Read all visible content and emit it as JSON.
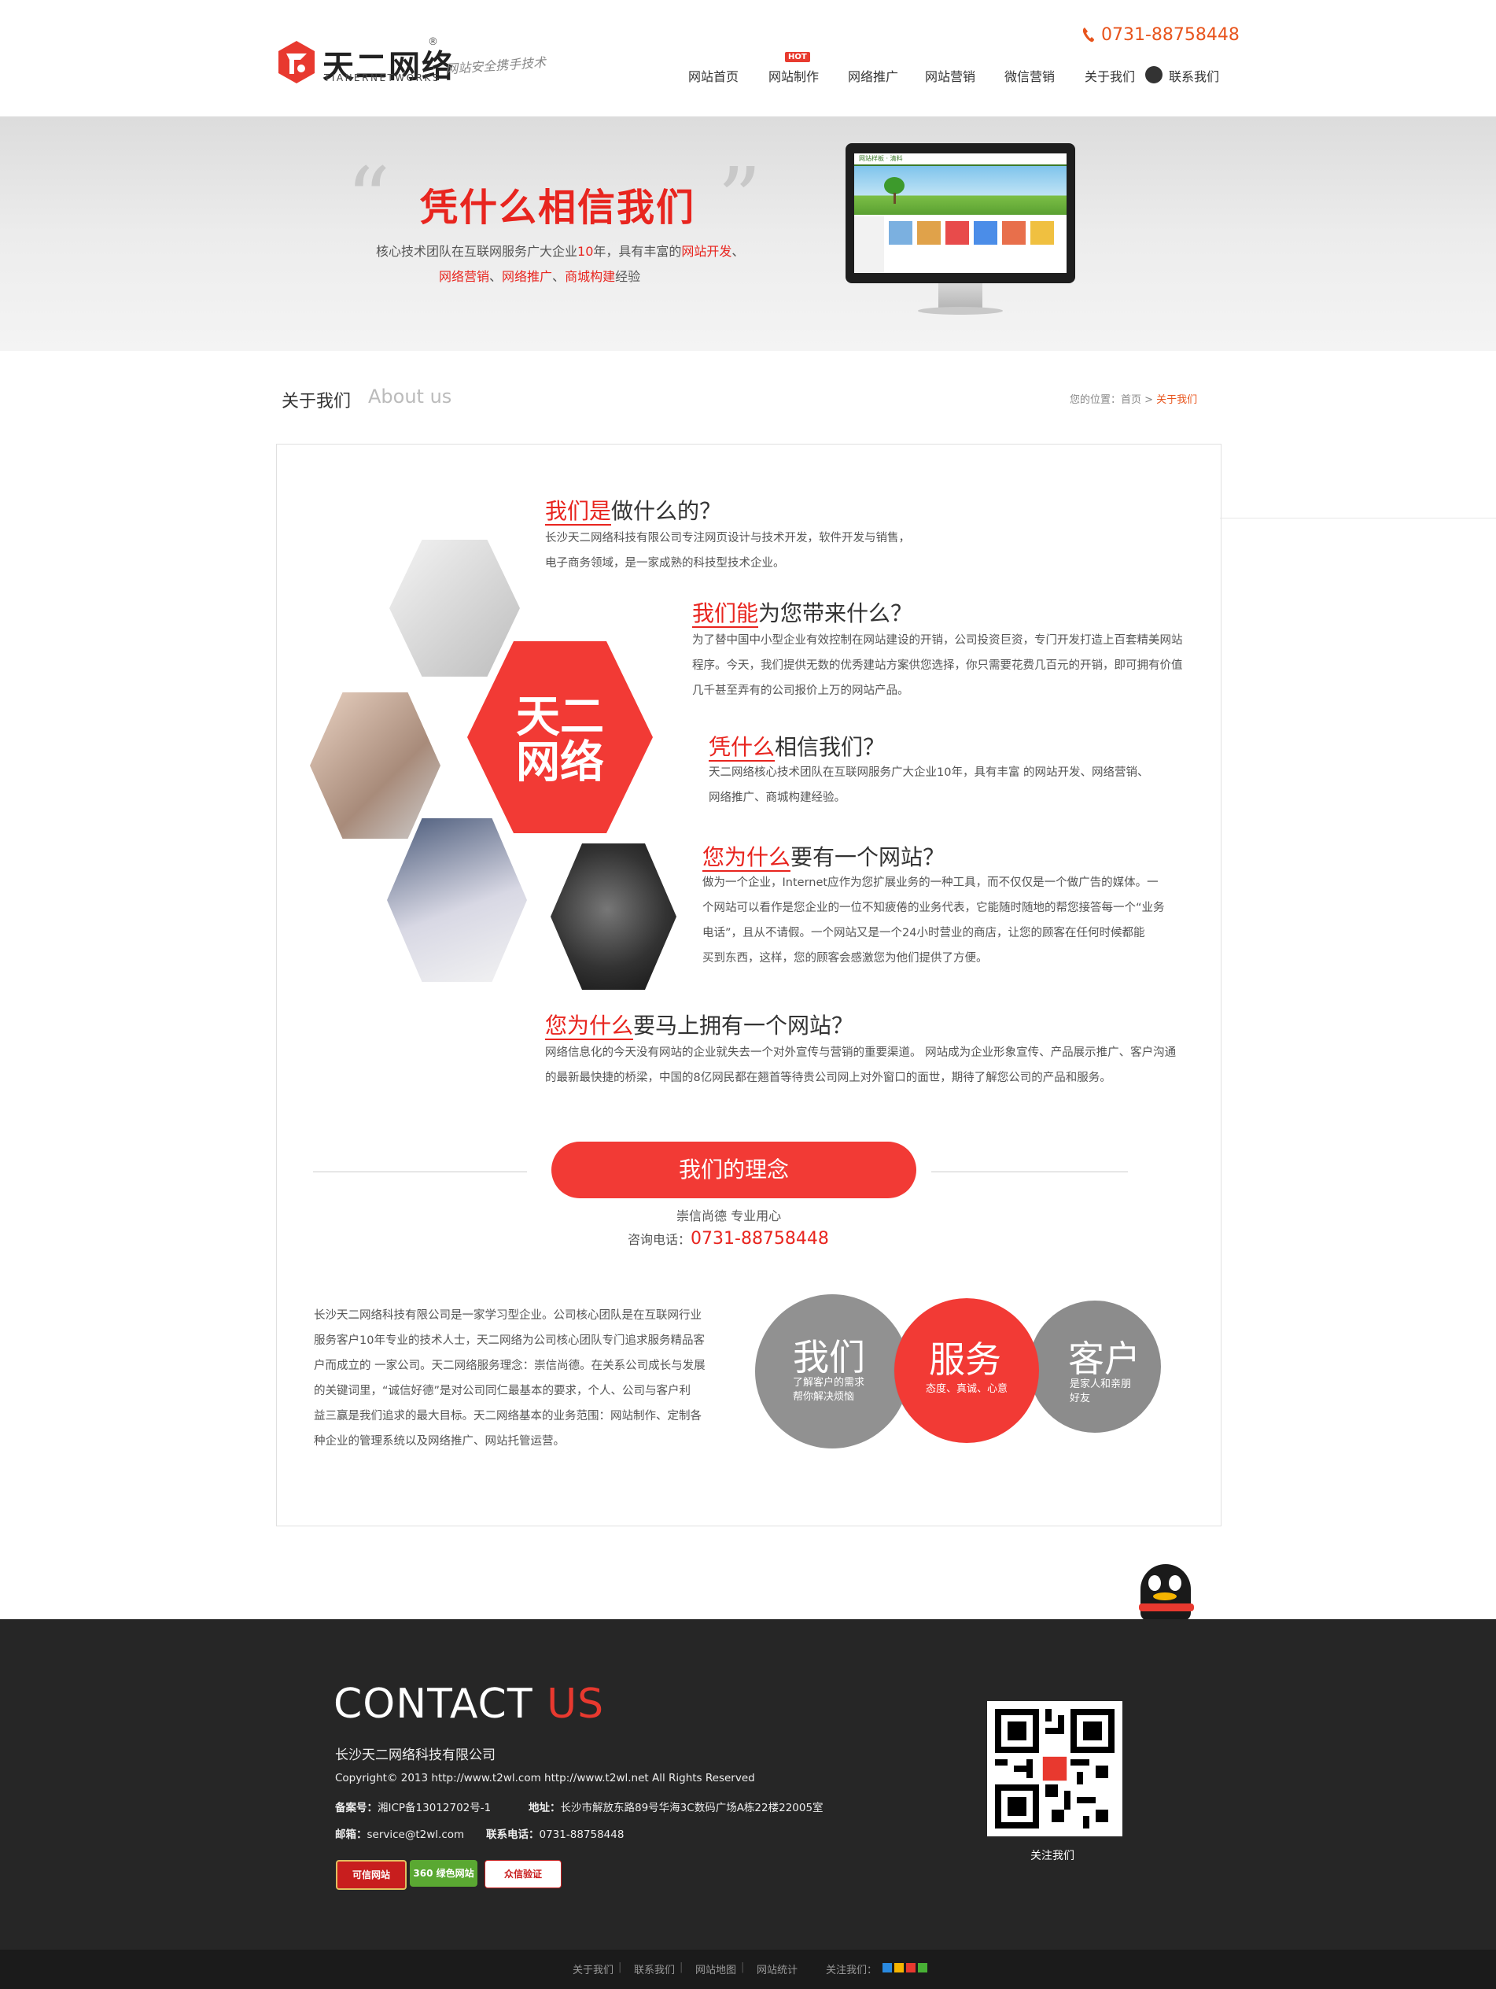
{
  "header": {
    "logo_cn": "天二网络",
    "logo_en": "TIANERNETWORKS",
    "logo_reg": "®",
    "slogan": "网站安全携手技术",
    "phone": "0731-88758448",
    "hot_badge": "HOT",
    "nav": [
      "网站首页",
      "网站制作",
      "网络推广",
      "网站营销",
      "微信营销",
      "关于我们",
      "联系我们"
    ]
  },
  "banner": {
    "title": "凭什么相信我们",
    "line1_a": "核心技术团队在互联网服务广大企业",
    "line1_num": "10",
    "line1_b": "年，具有丰富的",
    "line1_c": "网站开发",
    "line1_d": "、",
    "line2_a": "网络营销",
    "line2_b": "、",
    "line2_c": "网络推广",
    "line2_d": "、",
    "line2_e": "商城构建",
    "line2_f": "经验",
    "monitor_site_title": "网站样板 · 清料"
  },
  "section": {
    "title": "关于我们",
    "title_en": "About us",
    "crumb_prefix": "您的位置：首页 > ",
    "crumb_current": "关于我们"
  },
  "hex_center": {
    "line1": "天二",
    "line2": "网络"
  },
  "blocks": [
    {
      "ul": "我们是",
      "rest": "做什么的？",
      "text": [
        "长沙天二网络科技有限公司专注网页设计与技术开发，软件开发与销售，",
        "电子商务领域，是一家成熟的科技型技术企业。"
      ]
    },
    {
      "ul": "我们能",
      "rest": "为您带来什么？",
      "text": [
        "为了替中国中小型企业有效控制在网站建设的开销，公司投资巨资，专门开发打造上百套精美网站",
        "程序。今天，我们提供无数的优秀建站方案供您选择，你只需要花费几百元的开销，即可拥有价值",
        "几千甚至弄有的公司报价上万的网站产品。"
      ]
    },
    {
      "ul": "凭什么",
      "rest": "相信我们？",
      "text": [
        "天二网络核心技术团队在互联网服务广大企业10年，具有丰富 的网站开发、网络营销、",
        "网络推广、商城构建经验。"
      ]
    },
    {
      "ul": "您为什么",
      "rest": "要有一个网站？",
      "text": [
        "做为一个企业，Internet应作为您扩展业务的一种工具，而不仅仅是一个做广告的媒体。一",
        "个网站可以看作是您企业的一位不知疲倦的业务代表，它能随时随地的帮您接答每一个“业务",
        "电话”，且从不请假。一个网站又是一个24小时营业的商店，让您的顾客在任何时候都能",
        "买到东西，这样，您的顾客会感激您为他们提供了方便。"
      ]
    },
    {
      "ul": "您为什么",
      "rest": "要马上拥有一个网站？",
      "text": [
        "网络信息化的今天没有网站的企业就失去一个对外宣传与营销的重要渠道。 网站成为企业形象宣传、产品展示推广、客户沟通",
        "的最新最快捷的桥梁，中国的8亿网民都在翘首等待贵公司网上对外窗口的面世，期待了解您公司的产品和服务。"
      ]
    }
  ],
  "philosophy": {
    "button": "我们的理念",
    "sub": "崇信尚德  专业用心",
    "tel_label": "咨询电话：",
    "tel": "0731-88758448"
  },
  "intro": [
    "长沙天二网络科技有限公司是一家学习型企业。公司核心团队是在互联网行业",
    "服务客户10年专业的技术人士，天二网络为公司核心团队专门追求服务精品客",
    "户而成立的 一家公司。天二网络服务理念：崇信尚德。在关系公司成长与发展",
    "的关键词里，“诚信好德”是对公司同仁最基本的要求，个人、公司与客户利",
    "益三赢是我们追求的最大目标。天二网络基本的业务范围：网站制作、定制各",
    "种企业的管理系统以及网络推广、网站托管运营。"
  ],
  "circles": [
    {
      "title": "我们",
      "sub1": "了解客户的需求",
      "sub2": "帮你解决烦恼",
      "color": "#8c8c8c"
    },
    {
      "title": "服务",
      "sub1": "态度、真诚、心意",
      "sub2": "",
      "color": "#f23a35"
    },
    {
      "title": "客户",
      "sub1": "是家人和亲朋",
      "sub2": "好友",
      "color": "#8c8c8c"
    }
  ],
  "footer": {
    "contact_a": "CONTACT ",
    "contact_b": "US",
    "company": "长沙天二网络科技有限公司",
    "copyright": "Copyright© 2013 http://www.t2wl.com http://www.t2wl.net All Rights Reserved",
    "icp_label": "备案号：",
    "icp": "湘ICP备13012702号-1",
    "addr_label": "地址：",
    "addr": "长沙市解放东路89号华海3C数码广场A栋22楼22005室",
    "mail_label": "邮箱：",
    "mail": "service@t2wl.com",
    "tel_label": "联系电话：",
    "tel": "0731-88758448",
    "badges": [
      "可信网站",
      "360 绿色网站",
      "众信验证"
    ],
    "qr_label": "关注我们"
  },
  "bottom_bar": {
    "links": [
      "关于我们",
      "联系我们",
      "网站地图",
      "网站统计"
    ],
    "follow": "关注我们："
  },
  "colors": {
    "accent": "#e8251f",
    "footer_bg": "#262626",
    "orange": "#e8541c"
  }
}
